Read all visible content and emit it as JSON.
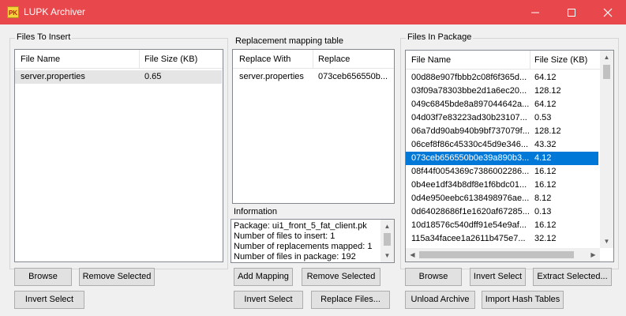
{
  "window": {
    "title": "LUPK Archiver",
    "icon_text": "PK",
    "minimize_icon": "minimize-icon",
    "maximize_icon": "maximize-icon",
    "close_icon": "close-icon"
  },
  "files_to_insert": {
    "title": "Files To Insert",
    "columns": [
      "File Name",
      "File Size (KB)"
    ],
    "rows": [
      {
        "name": "server.properties",
        "size": "0.65"
      }
    ],
    "buttons": {
      "browse": "Browse",
      "remove_selected": "Remove Selected",
      "invert_select": "Invert Select"
    }
  },
  "mapping": {
    "title": "Replacement mapping table",
    "columns": [
      "Replace With",
      "Replace"
    ],
    "rows": [
      {
        "with": "server.properties",
        "replace": "073ceb656550b..."
      }
    ],
    "buttons": {
      "add_mapping": "Add Mapping",
      "remove_selected": "Remove Selected",
      "invert_select": "Invert Select",
      "replace_files": "Replace Files..."
    }
  },
  "information": {
    "label": "Information",
    "lines": [
      "Package: ui1_front_5_fat_client.pk",
      "Number of files to insert: 1",
      "Number of replacements mapped: 1",
      "Number of files in package: 192"
    ]
  },
  "package": {
    "title": "Files In Package",
    "columns": [
      "File Name",
      "File Size (KB)"
    ],
    "rows": [
      {
        "name": "00d88e907fbbb2c08f6f365d...",
        "size": "64.12"
      },
      {
        "name": "03f09a78303bbe2d1a6ec20...",
        "size": "128.12"
      },
      {
        "name": "049c6845bde8a897044642a...",
        "size": "64.12"
      },
      {
        "name": "04d03f7e83223ad30b23107...",
        "size": "0.53"
      },
      {
        "name": "06a7dd90ab940b9bf737079f...",
        "size": "128.12"
      },
      {
        "name": "06cef8f86c45330c45d9e346...",
        "size": "43.32"
      },
      {
        "name": "073ceb656550b0e39a890b3...",
        "size": "4.12"
      },
      {
        "name": "08f44f0054369c7386002286...",
        "size": "16.12"
      },
      {
        "name": "0b4ee1df34b8df8e1f6bdc01...",
        "size": "16.12"
      },
      {
        "name": "0d4e950eebc6138498976ae...",
        "size": "8.12"
      },
      {
        "name": "0d64028686f1e1620af67285...",
        "size": "0.13"
      },
      {
        "name": "10d18576c540dff91e54e9af...",
        "size": "16.12"
      },
      {
        "name": "115a34facee1a2611b475e7...",
        "size": "32.12"
      }
    ],
    "selected_index": 6,
    "buttons": {
      "browse": "Browse",
      "invert_select": "Invert Select",
      "extract_selected": "Extract Selected...",
      "unload_archive": "Unload Archive",
      "import_hash_tables": "Import Hash Tables"
    }
  },
  "colors": {
    "titlebar": "#e8484b",
    "selection": "#0078d7",
    "row_highlight": "#e5e5e5"
  }
}
